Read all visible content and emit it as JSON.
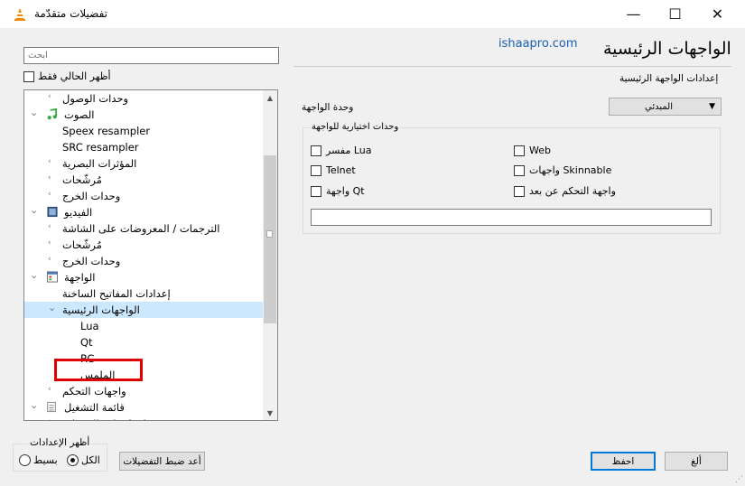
{
  "window": {
    "title": "تفضيلات متقدّمة",
    "minimize": "—",
    "maximize": "☐",
    "close": "✕"
  },
  "left": {
    "search_placeholder": "ابحث",
    "show_current_only": "أظهر الحالي فقط",
    "tree": [
      {
        "label": "وحدات الوصول",
        "level": 1,
        "chevron": "›"
      },
      {
        "label": "الصوت",
        "level": 0,
        "chevron": "⌄",
        "icon": "music"
      },
      {
        "label": "Speex resampler",
        "level": 1,
        "chevron": ""
      },
      {
        "label": "SRC resampler",
        "level": 1,
        "chevron": ""
      },
      {
        "label": "المؤثرات البصرية",
        "level": 1,
        "chevron": "›"
      },
      {
        "label": "مُرشّحات",
        "level": 1,
        "chevron": "›"
      },
      {
        "label": "وحدات الخرج",
        "level": 1,
        "chevron": "›"
      },
      {
        "label": "الفيديو",
        "level": 0,
        "chevron": "⌄",
        "icon": "film"
      },
      {
        "label": "الترجمات / المعروضات على الشاشة",
        "level": 1,
        "chevron": "›"
      },
      {
        "label": "مُرشّحات",
        "level": 1,
        "chevron": "›"
      },
      {
        "label": "وحدات الخرج",
        "level": 1,
        "chevron": "›"
      },
      {
        "label": "الواجهة",
        "level": 0,
        "chevron": "⌄",
        "icon": "interface"
      },
      {
        "label": "إعدادات المفاتيح الساخنة",
        "level": 1,
        "chevron": ""
      },
      {
        "label": "الواجهات الرئيسية",
        "level": 1,
        "chevron": "⌄",
        "selected": true
      },
      {
        "label": "Lua",
        "level": 2,
        "chevron": ""
      },
      {
        "label": "Qt",
        "level": 2,
        "chevron": ""
      },
      {
        "label": "RC",
        "level": 2,
        "chevron": ""
      },
      {
        "label": "الملمس",
        "level": 2,
        "chevron": ""
      },
      {
        "label": "واجهات التحكم",
        "level": 1,
        "chevron": "›"
      },
      {
        "label": "قائمة التشغيل",
        "level": 0,
        "chevron": "⌄",
        "icon": "playlist"
      },
      {
        "label": "استكشاف الخدمات",
        "level": 1,
        "chevron": "›"
      }
    ]
  },
  "right": {
    "title": "الواجهات الرئيسية",
    "watermark": "ishaapro.com",
    "subtitle": "إعدادات الواجهة الرئيسية",
    "module_label": "وحدة الواجهة",
    "module_value": "المبدئي",
    "extra_title": "وحدات اختيارية للواجهة",
    "checkboxes": [
      "Web",
      "مفسر Lua",
      "واجهات Skinnable",
      "Telnet",
      "واجهة التحكم عن بعد",
      "واجهة Qt"
    ]
  },
  "bottom": {
    "show_settings": "أظهر الإعدادات",
    "simple": "بسيط",
    "all": "الكل",
    "reset": "أعد ضبط التفضيلات",
    "save": "احفظ",
    "cancel": "ألغ"
  }
}
